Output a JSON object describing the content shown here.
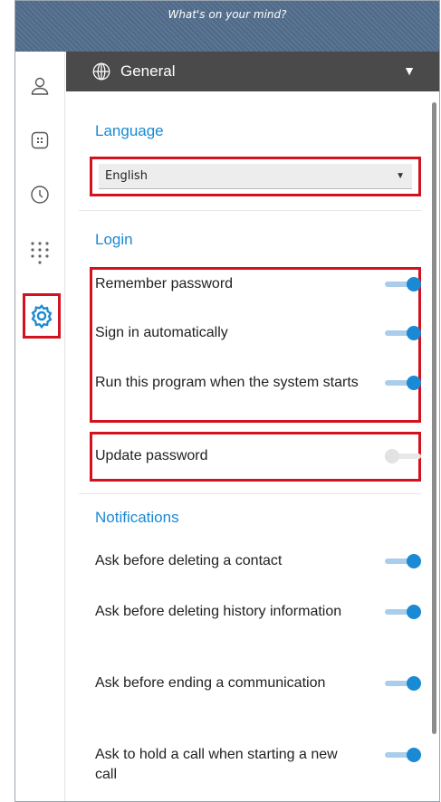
{
  "status_bar": {
    "placeholder": "What's on your mind?"
  },
  "rail": {
    "items": [
      {
        "name": "contacts",
        "icon": "person-icon"
      },
      {
        "name": "directory",
        "icon": "building-icon"
      },
      {
        "name": "history",
        "icon": "clock-icon"
      },
      {
        "name": "dialpad",
        "icon": "dialpad-icon"
      },
      {
        "name": "settings",
        "icon": "gear-icon",
        "active": true
      }
    ]
  },
  "section": {
    "title": "General",
    "icon": "globe-icon",
    "caret": "▼"
  },
  "language": {
    "heading": "Language",
    "select": {
      "value": "English",
      "arrow": "▼"
    }
  },
  "login": {
    "heading": "Login",
    "items": [
      {
        "label": "Remember password",
        "on": true
      },
      {
        "label": "Sign in automatically",
        "on": true
      },
      {
        "label": "Run this program when the system starts",
        "on": true
      },
      {
        "label": "Update password",
        "on": false
      }
    ]
  },
  "notifications": {
    "heading": "Notifications",
    "items": [
      {
        "label": "Ask before deleting a contact",
        "on": true
      },
      {
        "label": "Ask before deleting history information",
        "on": true
      },
      {
        "label": "Ask before ending a communication",
        "on": true
      },
      {
        "label": "Ask to hold a call when starting a new call",
        "on": true
      }
    ]
  },
  "colors": {
    "accent": "#1a8ad4",
    "highlight": "#d2121f",
    "header": "#4a4a4a"
  }
}
